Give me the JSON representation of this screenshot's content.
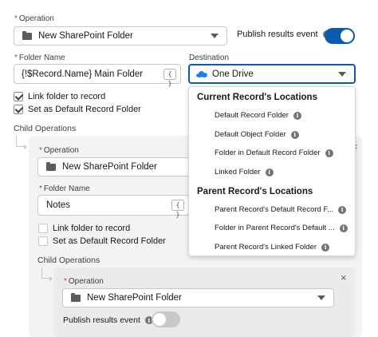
{
  "operation": {
    "label": "Operation",
    "value": "New SharePoint Folder",
    "publish_label": "Publish results event",
    "publish_on": true
  },
  "folder": {
    "label": "Folder Name",
    "value": "{!$Record.Name} Main Folder",
    "merge_icon": "{ }"
  },
  "destination": {
    "label": "Destination",
    "value": "One Drive",
    "dropdown": {
      "groups": [
        {
          "heading": "Current Record's Locations",
          "items": [
            "Default Record Folder",
            "Default Object Folder",
            "Folder in Default Record Folder",
            "Linked Folder"
          ]
        },
        {
          "heading": "Parent Record's Locations",
          "items": [
            "Parent Record's Default Record F...",
            "Folder in Parent Record's Default ...",
            "Parent Record's Linked Folder"
          ]
        }
      ]
    }
  },
  "options": {
    "link_label": "Link folder to record",
    "link_checked": true,
    "default_label": "Set as Default Record Folder",
    "default_checked": true
  },
  "child_ops_label": "Child Operations",
  "child1": {
    "operation_label": "Operation",
    "operation_value": "New SharePoint Folder",
    "folder_label": "Folder Name",
    "folder_value": "Notes",
    "merge_icon": "{ }",
    "link_label": "Link folder to record",
    "link_checked": false,
    "default_label": "Set as Default Record Folder",
    "default_checked": false,
    "child_ops_label": "Child Operations",
    "close_symbol": "×"
  },
  "child2": {
    "operation_label": "Operation",
    "operation_value": "New SharePoint Folder",
    "publish_label": "Publish results event",
    "publish_on": false,
    "close_symbol": "×"
  },
  "info_glyph": "i",
  "colors": {
    "toggle_on": "#0b5cab",
    "required": "#c23934",
    "onedrive": "#1b7ff0"
  }
}
